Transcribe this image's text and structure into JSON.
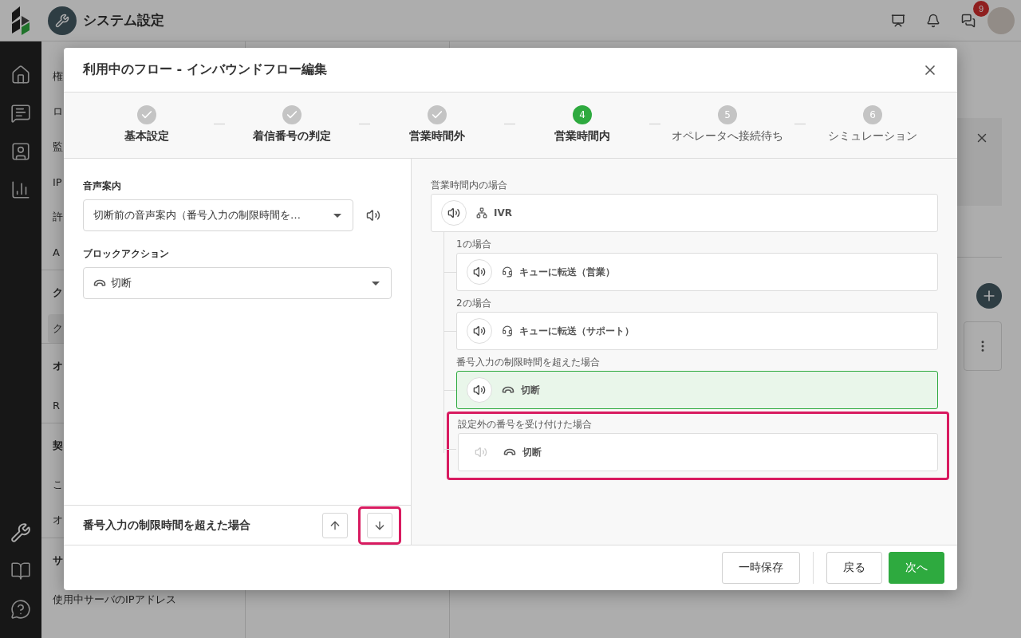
{
  "app_header": {
    "title": "システム設定",
    "notification_badge": "9"
  },
  "background_sidebar": {
    "items": [
      {
        "kind": "item",
        "label": "権",
        "selected": false
      },
      {
        "kind": "item",
        "label": "ロ",
        "selected": false
      },
      {
        "kind": "item",
        "label": "監",
        "selected": false
      },
      {
        "kind": "item",
        "label": "IP",
        "selected": false
      },
      {
        "kind": "item",
        "label": "許",
        "selected": false
      },
      {
        "kind": "item",
        "label": "A",
        "selected": false
      },
      {
        "kind": "header",
        "label": "ク"
      },
      {
        "kind": "item",
        "label": "ク",
        "selected": true
      },
      {
        "kind": "header",
        "label": "オ"
      },
      {
        "kind": "item",
        "label": "R",
        "selected": false
      },
      {
        "kind": "header",
        "label": "契"
      },
      {
        "kind": "item",
        "label": "こ",
        "selected": false
      },
      {
        "kind": "item",
        "label": "オ",
        "selected": false
      },
      {
        "kind": "header",
        "label": "サ"
      },
      {
        "kind": "item",
        "label": "使用中サーバのIPアドレス",
        "selected": false
      }
    ]
  },
  "modal": {
    "title": "利用中のフロー - インバウンドフロー編集",
    "steps": [
      {
        "completed": true,
        "selected": false,
        "label": "基本設定"
      },
      {
        "completed": true,
        "selected": false,
        "label": "着信番号の判定"
      },
      {
        "completed": true,
        "selected": false,
        "label": "営業時間外"
      },
      {
        "completed": false,
        "selected": true,
        "number": "4",
        "label": "営業時間内"
      },
      {
        "completed": false,
        "selected": false,
        "number": "5",
        "label": "オペレータへ接続待ち"
      },
      {
        "completed": false,
        "selected": false,
        "number": "6",
        "label": "シミュレーション"
      }
    ],
    "settings": {
      "voice_guidance": {
        "label": "音声案内",
        "value": "切断前の音声案内（番号入力の制限時間を…"
      },
      "block_action": {
        "label": "ブロックアクション",
        "value": "切断",
        "kind": "hangup"
      },
      "footer_label": "番号入力の制限時間を超えた場合",
      "move_down_highlighted": true
    },
    "flow": {
      "root_label": "営業時間内の場合",
      "root": {
        "kind": "ivr",
        "text": "IVR",
        "audio_enabled": true
      },
      "branches": [
        {
          "label": "1の場合",
          "kind": "queue",
          "text": "キューに転送（営業）",
          "audio_enabled": true,
          "selected": false,
          "highlighted": false
        },
        {
          "label": "2の場合",
          "kind": "queue",
          "text": "キューに転送（サポート）",
          "audio_enabled": true,
          "selected": false,
          "highlighted": false
        },
        {
          "label": "番号入力の制限時間を超えた場合",
          "kind": "hangup",
          "text": "切断",
          "audio_enabled": true,
          "selected": true,
          "highlighted": false
        },
        {
          "label": "設定外の番号を受け付けた場合",
          "kind": "hangup",
          "text": "切断",
          "audio_enabled": false,
          "selected": false,
          "highlighted": true
        }
      ]
    },
    "buttons": [
      {
        "label": "一時保存",
        "kind": "default"
      },
      {
        "kind": "divider"
      },
      {
        "label": "戻る",
        "kind": "default"
      },
      {
        "label": "次へ",
        "kind": "primary"
      }
    ]
  }
}
